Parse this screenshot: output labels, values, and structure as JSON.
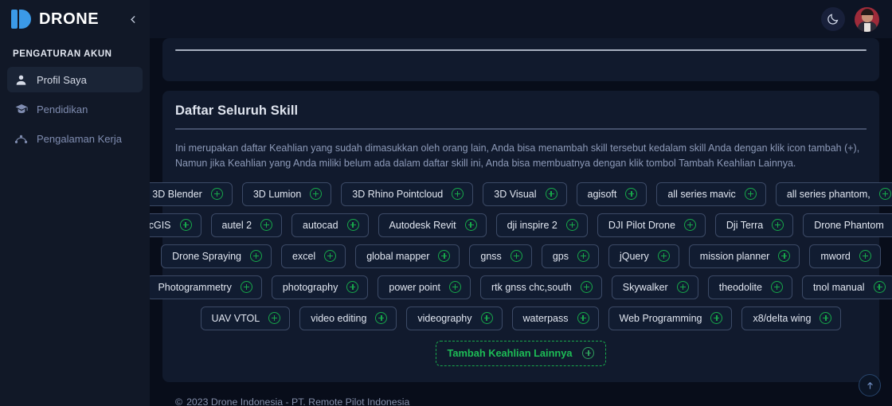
{
  "sidebar": {
    "brand": "DRONE",
    "collapse_icon": "chevron-left-icon",
    "section_title": "PENGATURAN AKUN",
    "items": [
      {
        "label": "Profil Saya",
        "icon": "user-icon",
        "active": true
      },
      {
        "label": "Pendidikan",
        "icon": "graduation-cap-icon",
        "active": false
      },
      {
        "label": "Pengalaman Kerja",
        "icon": "network-icon",
        "active": false
      }
    ]
  },
  "topbar": {
    "theme_toggle_icon": "moon-icon",
    "avatar_icon": "user-avatar"
  },
  "card": {
    "title": "Daftar Seluruh Skill",
    "description": "Ini merupakan daftar Keahlian yang sudah dimasukkan oleh orang lain, Anda bisa menambah skill tersebut kedalam skill Anda dengan klik icon tambah (+), Namun jika Keahlian yang Anda miliki belum ada dalam daftar skill ini, Anda bisa membuatnya dengan klik tombol Tambah Keahlian Lainnya.",
    "add_button_label": "Tambah Keahlian Lainnya",
    "add_icon": "plus-circle-icon",
    "skill_rows": [
      [
        "3D Blender",
        "3D Lumion",
        "3D Rhino Pointcloud",
        "3D Visual",
        "agisoft",
        "all series mavic",
        "all series phantom,"
      ],
      [
        "ArcGIS",
        "autel 2",
        "autocad",
        "Autodesk Revit",
        "dji inspire 2",
        "DJI Pilot Drone",
        "Dji Terra",
        "Drone Phantom"
      ],
      [
        "Drone Spraying",
        "excel",
        "global mapper",
        "gnss",
        "gps",
        "jQuery",
        "mission planner",
        "mword"
      ],
      [
        "Photogrammetry",
        "photography",
        "power point",
        "rtk gnss chc,south",
        "Skywalker",
        "theodolite",
        "tnol manual"
      ],
      [
        "UAV VTOL",
        "video editing",
        "videography",
        "waterpass",
        "Web Programming",
        "x8/delta wing"
      ]
    ]
  },
  "footer": {
    "copyright_symbol": "©",
    "text": "2023 Drone Indonesia - PT. Remote Pilot Indonesia"
  },
  "scroll_top": {
    "icon": "arrow-up-icon"
  },
  "colors": {
    "accent_green": "#17a84a",
    "brand_blue": "#3b9ae8",
    "sidebar_bg": "#111827",
    "card_bg": "#111a2d",
    "page_bg": "#080d1a"
  }
}
